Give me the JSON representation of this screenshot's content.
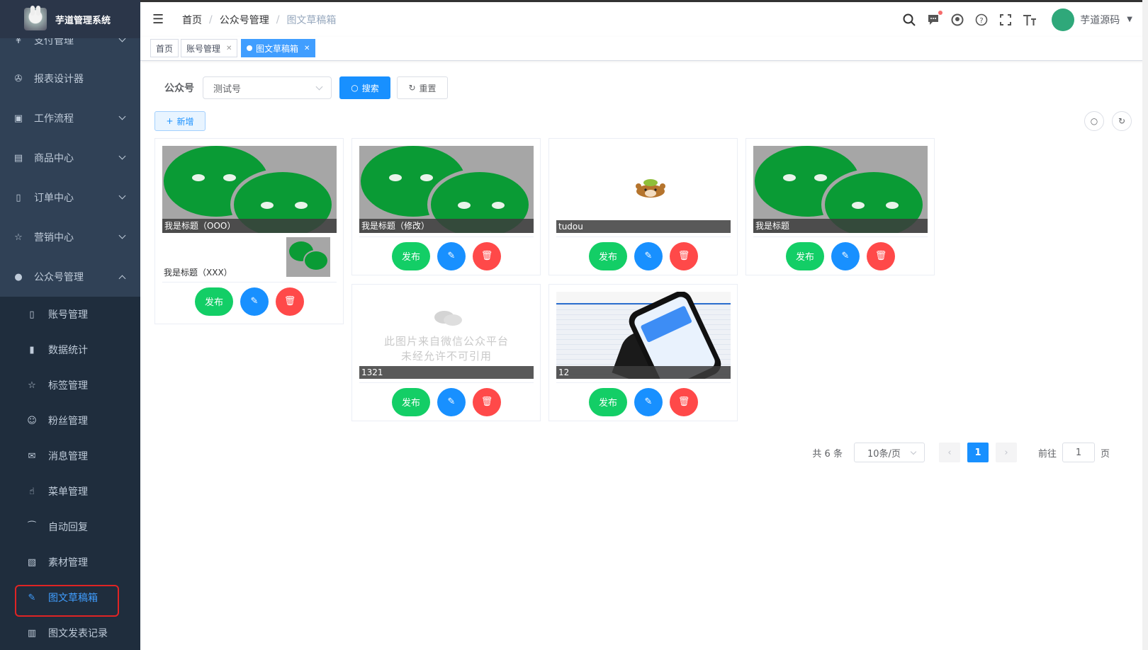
{
  "sidebar": {
    "app_title": "芋道管理系统",
    "items": [
      {
        "label": "支付管理"
      },
      {
        "label": "报表设计器"
      },
      {
        "label": "工作流程"
      },
      {
        "label": "商品中心"
      },
      {
        "label": "订单中心"
      },
      {
        "label": "营销中心"
      },
      {
        "label": "公众号管理"
      }
    ],
    "sub_items": [
      {
        "label": "账号管理"
      },
      {
        "label": "数据统计"
      },
      {
        "label": "标签管理"
      },
      {
        "label": "粉丝管理"
      },
      {
        "label": "消息管理"
      },
      {
        "label": "菜单管理"
      },
      {
        "label": "自动回复"
      },
      {
        "label": "素材管理"
      },
      {
        "label": "图文草稿箱"
      },
      {
        "label": "图文发表记录"
      }
    ]
  },
  "header": {
    "breadcrumb": [
      "首页",
      "公众号管理",
      "图文草稿箱"
    ],
    "username": "芋道源码",
    "icons": [
      "search-icon",
      "message-icon",
      "github-icon",
      "question-icon",
      "fullscreen-icon",
      "font-size-icon"
    ]
  },
  "tags": [
    {
      "label": "首页"
    },
    {
      "label": "账号管理"
    },
    {
      "label": "图文草稿箱"
    }
  ],
  "search": {
    "label": "公众号",
    "select_value": "测试号",
    "search_button": "搜索",
    "reset_button": "重置",
    "add_button": "新增"
  },
  "cards": [
    {
      "title": "我是标题（OOO）",
      "subtitle": "我是标题（XXX）",
      "image": "wechat"
    },
    {
      "title": "我是标题（修改）",
      "image": "wechat"
    },
    {
      "title": "tudou",
      "image": "bear"
    },
    {
      "title": "我是标题",
      "image": "wechat"
    },
    {
      "title": "1321",
      "image": "placeholder",
      "watermark_line1": "此图片来自微信公众平台",
      "watermark_line2": "未经允许不可引用"
    },
    {
      "title": "12",
      "image": "phone"
    }
  ],
  "card_actions": {
    "publish": "发布"
  },
  "pagination": {
    "total_text": "共 6 条",
    "page_size": "10条/页",
    "current_page": "1",
    "goto_prefix": "前往",
    "goto_value": "1",
    "goto_suffix": "页"
  },
  "colors": {
    "sidebar_bg": "#304156",
    "primary": "#1890ff",
    "success": "#13ce66",
    "danger": "#ff4949"
  }
}
